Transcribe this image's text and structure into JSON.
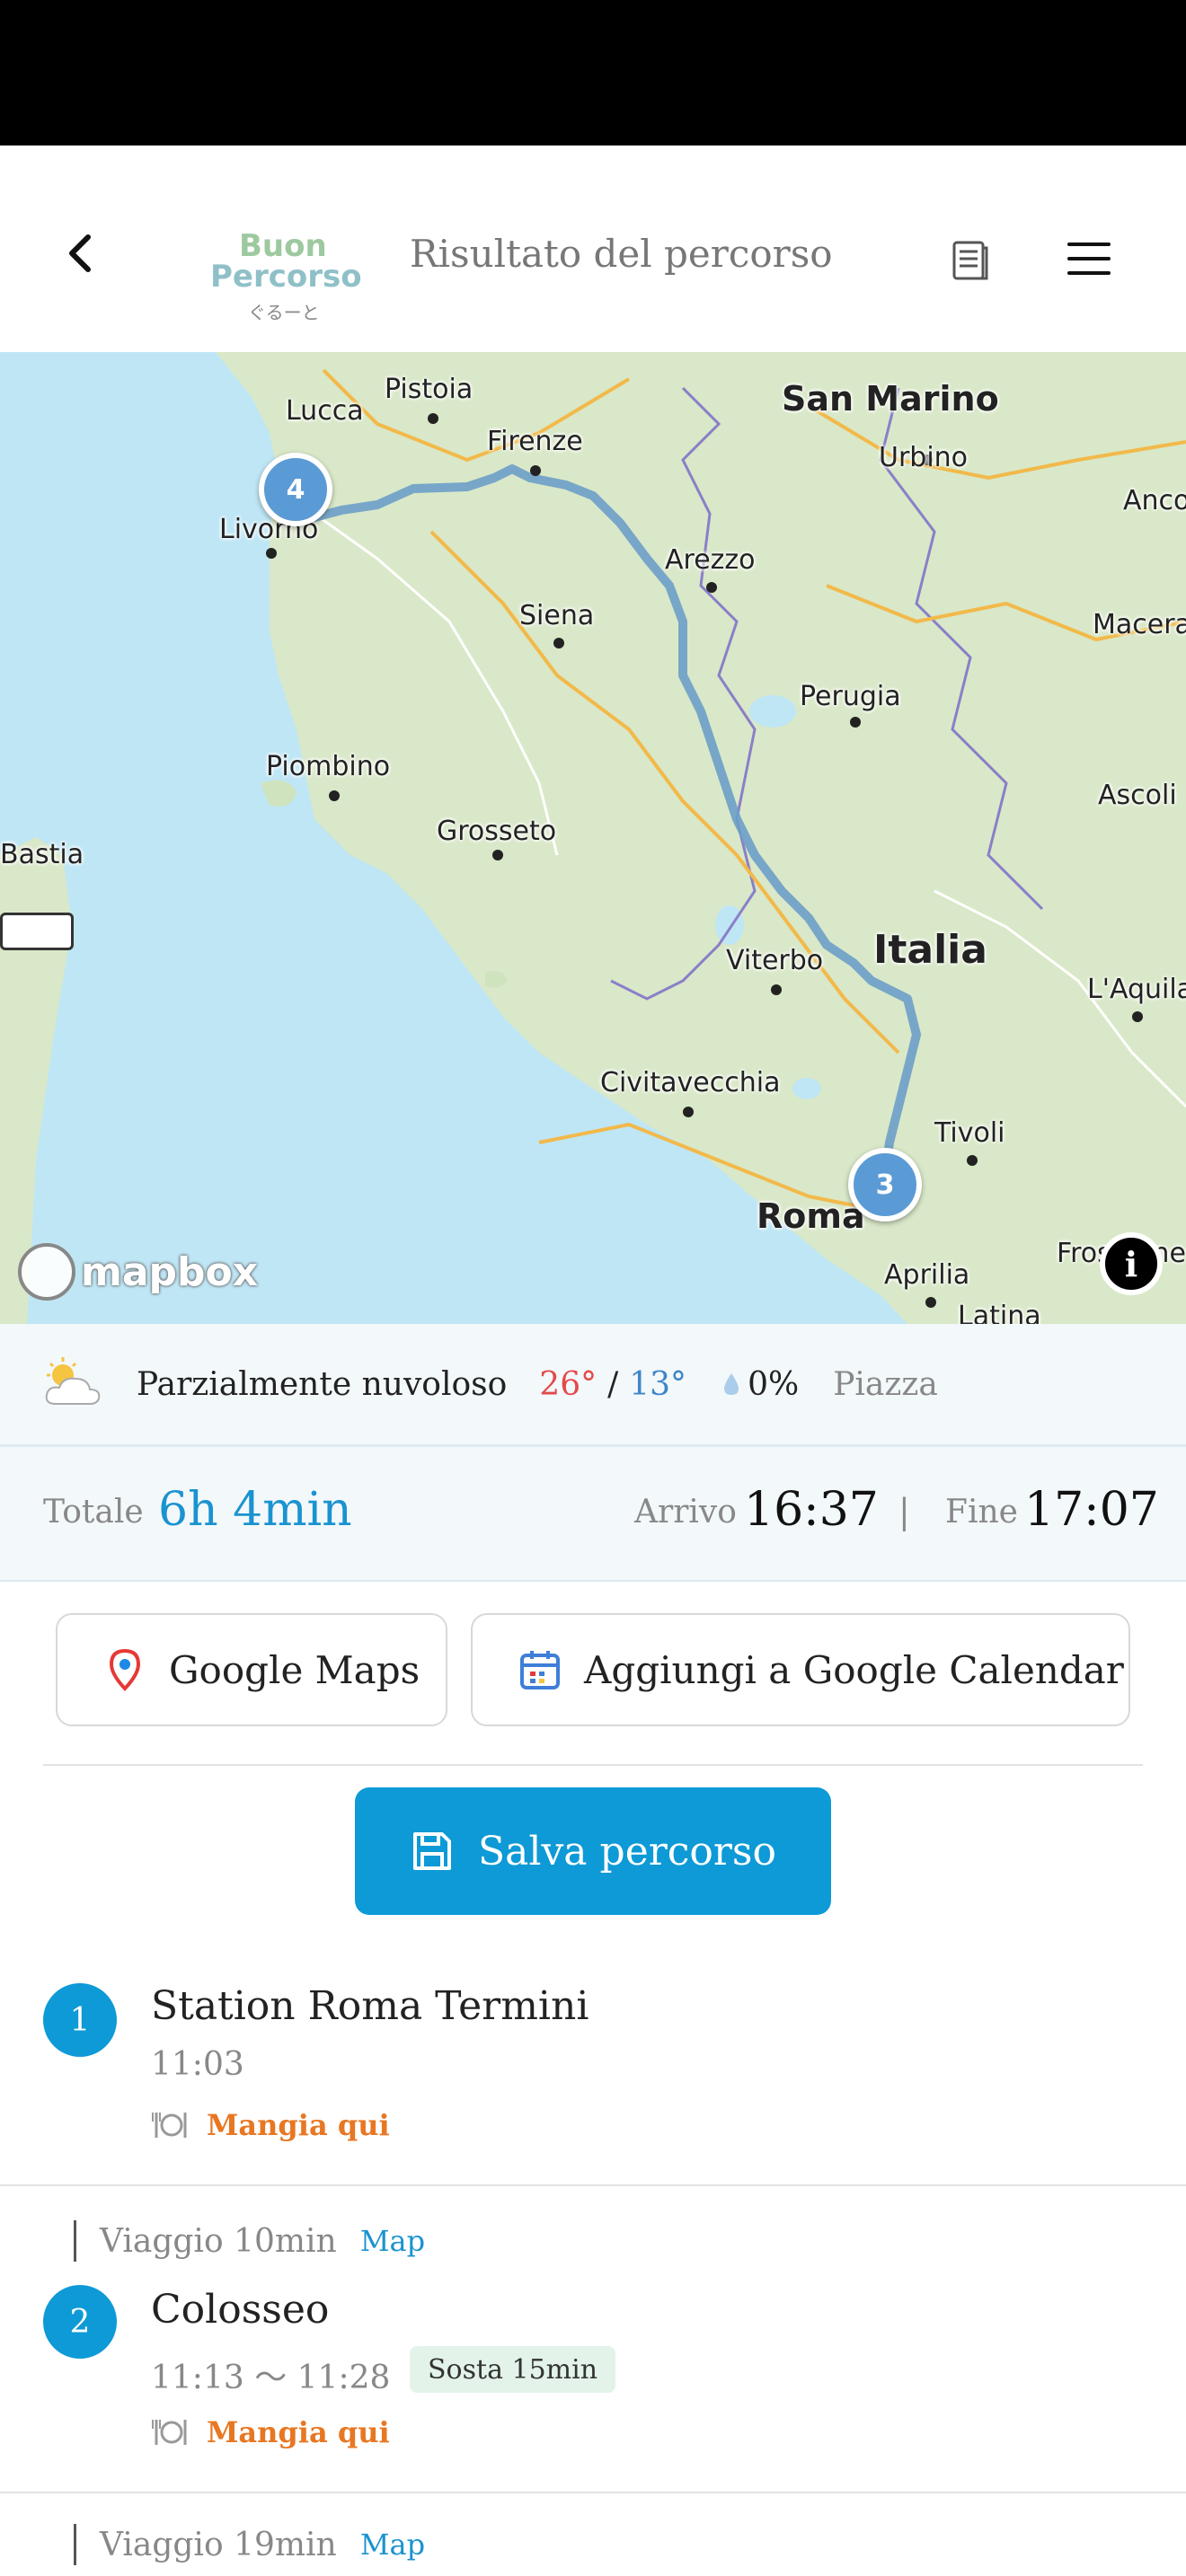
{
  "header": {
    "title": "Risultato del percorso",
    "logo": {
      "line1": "Buon",
      "line2": "Percorso",
      "line3": "ぐるーと"
    }
  },
  "map": {
    "labels": [
      "Lucca",
      "Pistoia",
      "Firenze",
      "San Marino",
      "Urbino",
      "Livorno",
      "Arezzo",
      "Siena",
      "Perugia",
      "Piombino",
      "Grosseto",
      "Bastia",
      "Viterbo",
      "Italia",
      "Civitavecchia",
      "Tivoli",
      "Roma",
      "Aprilia",
      "Ancona",
      "Macerata",
      "Ascoli",
      "L'Aquila",
      "Frosinone",
      "Latina"
    ],
    "markers": [
      "4",
      "3"
    ],
    "attribution": "mapbox",
    "info": "i"
  },
  "weather": {
    "description": "Parzialmente nuvoloso",
    "high": "26°",
    "separator": "/",
    "low": "13°",
    "rain": "0%",
    "place": "Piazza",
    "icon": "partly-cloudy-icon"
  },
  "totals": {
    "total_label": "Totale",
    "total_value": "6h 4min",
    "arrival_label": "Arrivo",
    "arrival_value": "16:37",
    "divider": "|",
    "end_label": "Fine",
    "end_value": "17:07"
  },
  "actions": {
    "google_maps": "Google Maps",
    "google_calendar": "Aggiungi a Google Calendar",
    "save_route": "Salva percorso"
  },
  "stops": [
    {
      "number": "1",
      "name": "Station Roma Termini",
      "time": "11:03",
      "eat": "Mangia qui"
    },
    {
      "number": "2",
      "name": "Colosseo",
      "time": "11:13 〜 11:28",
      "stay": "Sosta 15min",
      "eat": "Mangia qui"
    }
  ],
  "travel": [
    {
      "text": "Viaggio 10min",
      "link": "Map"
    },
    {
      "text": "Viaggio 19min",
      "link": "Map"
    }
  ],
  "colors": {
    "accent": "#0d9ad6",
    "eat": "#e87722",
    "high": "#e34a4a",
    "low": "#3e86c8"
  }
}
